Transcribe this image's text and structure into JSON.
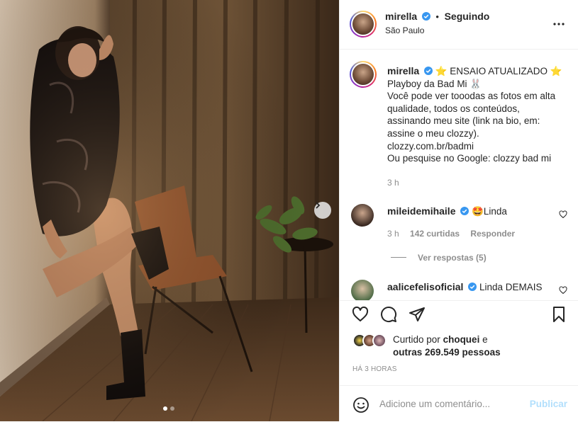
{
  "post_header": {
    "username": "mirella",
    "separator": "•",
    "follow_status": "Seguindo",
    "location": "São Paulo"
  },
  "caption": {
    "username": "mirella",
    "line1": "⭐ ENSAIO ATUALIZADO ⭐",
    "line2": "Playboy da Bad Mi 🐰",
    "line3": "Você pode ver tooodas as fotos em alta",
    "line4": "qualidade, todos os conteúdos,",
    "line5": "assinando meu site (link na bio, em:",
    "line6": "assine o meu clozzy).",
    "line7": "clozzy.com.br/badmi",
    "line8": "Ou pesquise no Google: clozzy bad mi",
    "time": "3 h"
  },
  "comments": [
    {
      "username": "mileidemihaile",
      "text": "🤩Linda",
      "time": "3 h",
      "likes": "142 curtidas",
      "reply": "Responder",
      "view_replies": "Ver respostas (5)"
    },
    {
      "username": "aalicefelisoficial",
      "text": "Linda DEMAIS"
    }
  ],
  "likes": {
    "prefix": "Curtido por",
    "user": "choquei",
    "middle": "e",
    "others": "outras 269.549 pessoas"
  },
  "timestamp": "HÁ 3 HORAS",
  "comment_box": {
    "placeholder": "Adicione um comentário...",
    "publish": "Publicar"
  },
  "colors": {
    "verified": "#3897f0",
    "publish_disabled": "#b2dffc",
    "secondary_text": "#8e8e8e"
  },
  "carousel": {
    "total": 2,
    "current": 1
  }
}
